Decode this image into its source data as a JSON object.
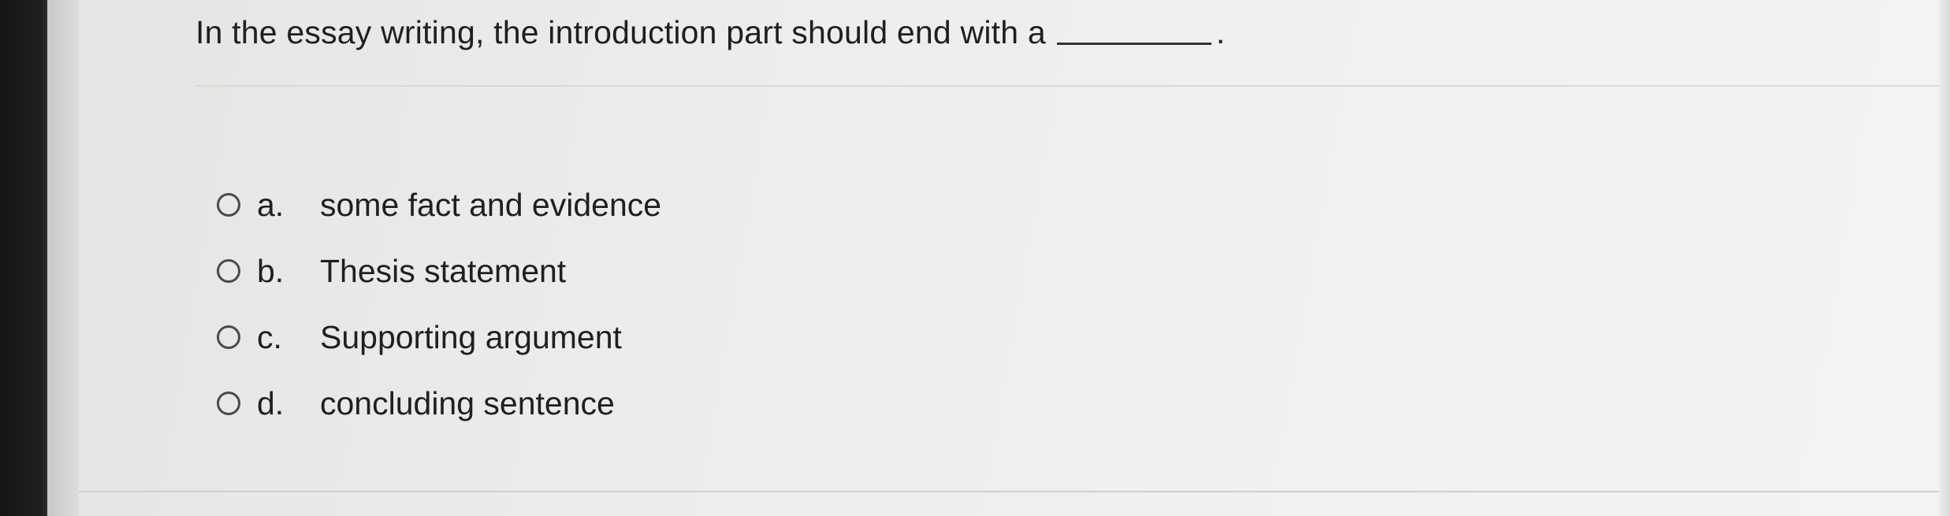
{
  "question": {
    "text": "In the essay writing, the introduction part should end with a",
    "trailing": "."
  },
  "options": [
    {
      "letter": "a.",
      "text": "some fact and evidence"
    },
    {
      "letter": "b.",
      "text": "Thesis statement"
    },
    {
      "letter": "c.",
      "text": "Supporting argument"
    },
    {
      "letter": "d.",
      "text": "concluding sentence"
    }
  ]
}
